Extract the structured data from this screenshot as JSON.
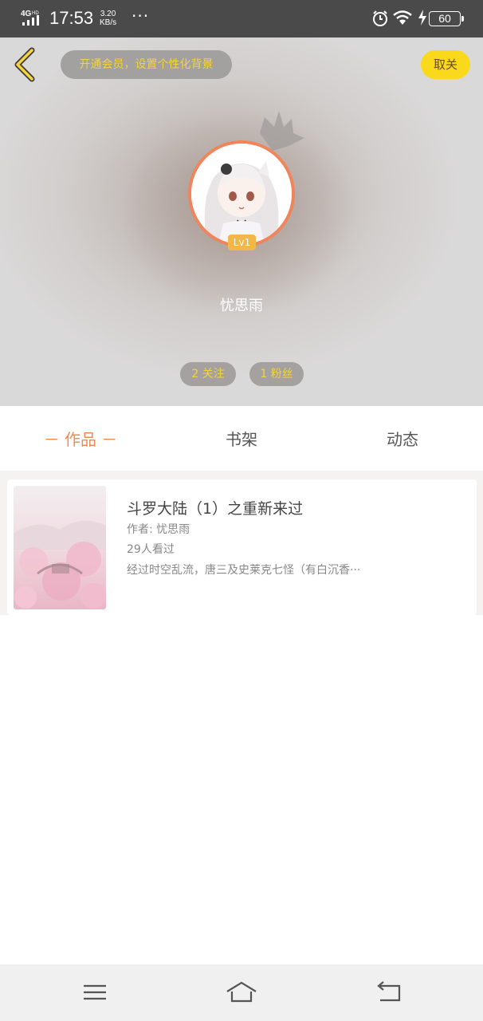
{
  "status_bar": {
    "network": "4G",
    "network_sub": "HD",
    "time": "17:53",
    "speed_value": "3.20",
    "speed_unit": "KB/s",
    "more": "···",
    "battery": "60"
  },
  "header": {
    "vip_prompt": "开通会员，设置个性化背景",
    "follow_label": "取关",
    "level": "Lv1",
    "username": "忧思雨",
    "following": "2 关注",
    "fans": "1 粉丝"
  },
  "tabs": [
    {
      "label": "－ 作品 －",
      "active": true
    },
    {
      "label": "书架",
      "active": false
    },
    {
      "label": "动态",
      "active": false
    }
  ],
  "books": [
    {
      "title": "斗罗大陆（1）之重新来过",
      "author": "作者: 忧思雨",
      "views": "29人看过",
      "description": "经过时空乱流，唐三及史莱克七怪（有白沉香···"
    }
  ],
  "colors": {
    "accent": "#f08a50",
    "vip_text": "#f5d33a",
    "follow_button": "#fad81b",
    "avatar_ring": "#f0845b",
    "level_badge": "#f1b748"
  }
}
